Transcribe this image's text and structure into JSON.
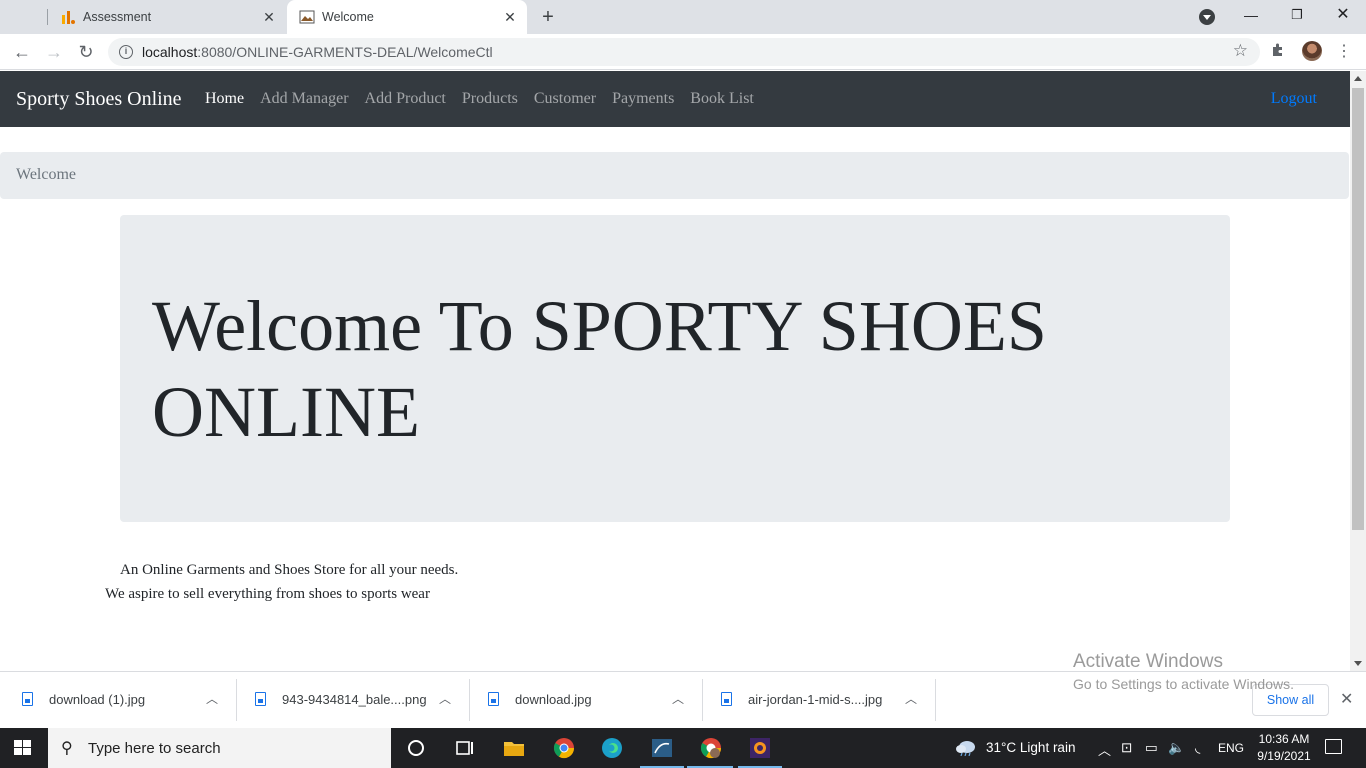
{
  "browser": {
    "tabs": [
      {
        "title": "Assessment",
        "active": false
      },
      {
        "title": "Welcome",
        "active": true
      }
    ],
    "url_host": "localhost",
    "url_path": ":8080/ONLINE-GARMENTS-DEAL/WelcomeCtl"
  },
  "site": {
    "brand": "Sporty Shoes Online",
    "nav": [
      "Home",
      "Add Manager",
      "Add Product",
      "Products",
      "Customer",
      "Payments",
      "Book List"
    ],
    "logout": "Logout",
    "breadcrumb": "Welcome",
    "jumbotron_heading": "Welcome To SPORTY SHOES ONLINE",
    "about_line1": "An Online Garments and Shoes Store for all your needs.",
    "about_line2": "We aspire to sell everything from shoes to sports wear",
    "colors": {
      "navbar": "#343a40",
      "link": "#007bff",
      "jumbotron": "#e9ecef"
    }
  },
  "downloads": {
    "items": [
      "download (1).jpg",
      "943-9434814_bale....png",
      "download.jpg",
      "air-jordan-1-mid-s....jpg"
    ],
    "show_all": "Show all"
  },
  "watermark": {
    "line1": "Activate Windows",
    "line2": "Go to Settings to activate Windows."
  },
  "taskbar": {
    "search_placeholder": "Type here to search",
    "weather": "31°C  Light rain",
    "language": "ENG",
    "time": "10:36 AM",
    "date": "9/19/2021"
  }
}
